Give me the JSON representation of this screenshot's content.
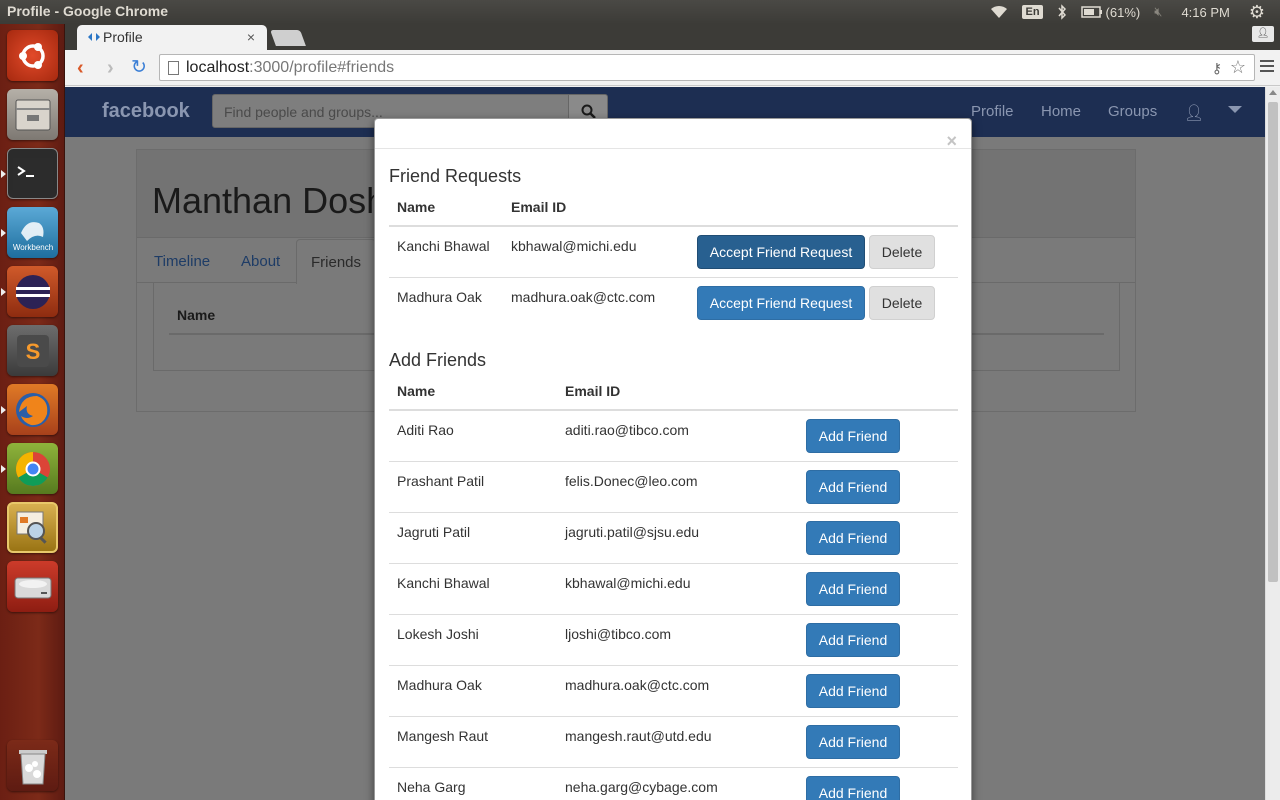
{
  "os": {
    "window_title": "Profile - Google Chrome",
    "keyboard_lang": "En",
    "battery": "(61%)",
    "clock": "4:16 PM"
  },
  "launcher": {
    "icons": [
      "ubuntu-dash-icon",
      "files-icon",
      "terminal-icon",
      "mysql-workbench-icon",
      "eclipse-icon",
      "sublime-text-icon",
      "firefox-icon",
      "chrome-icon",
      "image-viewer-icon",
      "disk-icon",
      "trash-icon"
    ]
  },
  "browser": {
    "tab_title": "Profile",
    "url_host": "localhost",
    "url_rest": ":3000/profile#friends"
  },
  "navbar": {
    "brand": "facebook",
    "search_placeholder": "Find people and groups...",
    "links": [
      "Profile",
      "Home",
      "Groups"
    ]
  },
  "page": {
    "profile_name": "Manthan Doshi",
    "tabs": [
      "Timeline",
      "About",
      "Friends"
    ],
    "panel_header": "Name"
  },
  "modal": {
    "close_label": "×",
    "requests_title": "Friend Requests",
    "requests_headers": [
      "Name",
      "Email ID"
    ],
    "requests": [
      {
        "name": "Kanchi Bhawal",
        "email": "kbhawal@michi.edu",
        "accept": "Accept Friend Request",
        "delete": "Delete"
      },
      {
        "name": "Madhura Oak",
        "email": "madhura.oak@ctc.com",
        "accept": "Accept Friend Request",
        "delete": "Delete"
      }
    ],
    "add_title": "Add Friends",
    "add_headers": [
      "Name",
      "Email ID"
    ],
    "add_button": "Add Friend",
    "people": [
      {
        "name": "Aditi Rao",
        "email": "aditi.rao@tibco.com"
      },
      {
        "name": "Prashant Patil",
        "email": "felis.Donec@leo.com"
      },
      {
        "name": "Jagruti Patil",
        "email": "jagruti.patil@sjsu.edu"
      },
      {
        "name": "Kanchi Bhawal",
        "email": "kbhawal@michi.edu"
      },
      {
        "name": "Lokesh Joshi",
        "email": "ljoshi@tibco.com"
      },
      {
        "name": "Madhura Oak",
        "email": "madhura.oak@ctc.com"
      },
      {
        "name": "Mangesh Raut",
        "email": "mangesh.raut@utd.edu"
      },
      {
        "name": "Neha Garg",
        "email": "neha.garg@cybage.com"
      }
    ]
  }
}
